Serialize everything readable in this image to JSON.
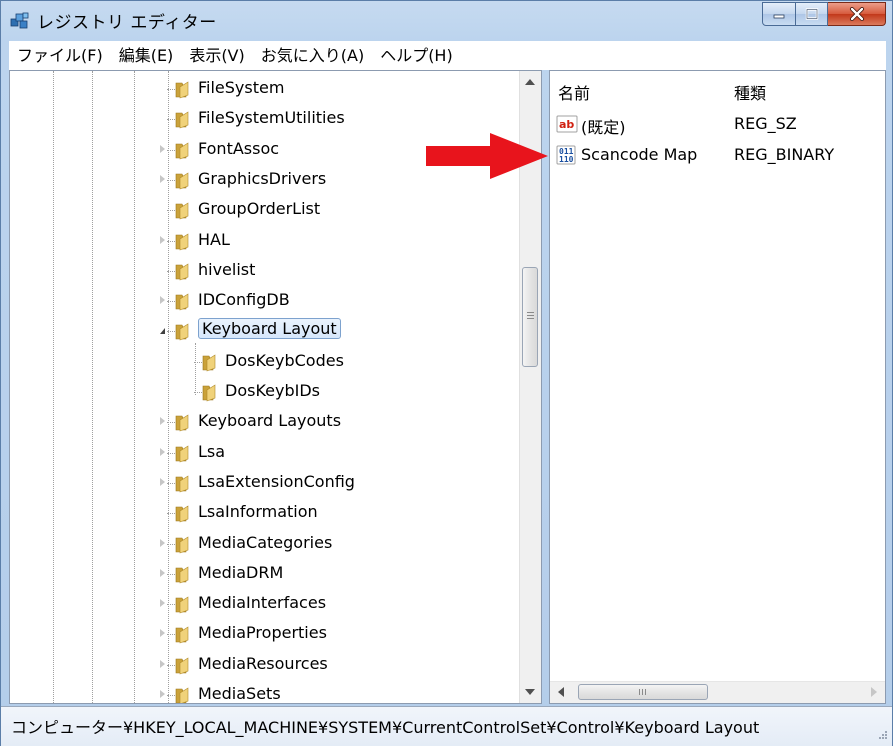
{
  "window": {
    "title": "レジストリ エディター",
    "accent_close": "#c7442a"
  },
  "menu": [
    {
      "label": "ファイル(F)"
    },
    {
      "label": "編集(E)"
    },
    {
      "label": "表示(V)"
    },
    {
      "label": "お気に入り(A)"
    },
    {
      "label": "ヘルプ(H)"
    }
  ],
  "tree": {
    "items": [
      {
        "label": "FileSystem",
        "expander": "none",
        "depth": 0
      },
      {
        "label": "FileSystemUtilities",
        "expander": "none",
        "depth": 0
      },
      {
        "label": "FontAssoc",
        "expander": "collapsed",
        "depth": 0
      },
      {
        "label": "GraphicsDrivers",
        "expander": "collapsed",
        "depth": 0
      },
      {
        "label": "GroupOrderList",
        "expander": "none",
        "depth": 0
      },
      {
        "label": "HAL",
        "expander": "collapsed",
        "depth": 0
      },
      {
        "label": "hivelist",
        "expander": "none",
        "depth": 0
      },
      {
        "label": "IDConfigDB",
        "expander": "collapsed",
        "depth": 0
      },
      {
        "label": "Keyboard Layout",
        "expander": "expanded",
        "depth": 0,
        "selected": true
      },
      {
        "label": "DosKeybCodes",
        "expander": "none",
        "depth": 1
      },
      {
        "label": "DosKeybIDs",
        "expander": "none",
        "depth": 1
      },
      {
        "label": "Keyboard Layouts",
        "expander": "collapsed",
        "depth": 0
      },
      {
        "label": "Lsa",
        "expander": "collapsed",
        "depth": 0
      },
      {
        "label": "LsaExtensionConfig",
        "expander": "collapsed",
        "depth": 0
      },
      {
        "label": "LsaInformation",
        "expander": "none",
        "depth": 0
      },
      {
        "label": "MediaCategories",
        "expander": "collapsed",
        "depth": 0
      },
      {
        "label": "MediaDRM",
        "expander": "collapsed",
        "depth": 0
      },
      {
        "label": "MediaInterfaces",
        "expander": "collapsed",
        "depth": 0
      },
      {
        "label": "MediaProperties",
        "expander": "collapsed",
        "depth": 0
      },
      {
        "label": "MediaResources",
        "expander": "collapsed",
        "depth": 0
      },
      {
        "label": "MediaSets",
        "expander": "collapsed",
        "depth": 0
      }
    ]
  },
  "list": {
    "columns": {
      "name": "名前",
      "type": "種類"
    },
    "rows": [
      {
        "name": "(既定)",
        "type": "REG_SZ",
        "icon": "string-value-icon"
      },
      {
        "name": "Scancode Map",
        "type": "REG_BINARY",
        "icon": "binary-value-icon"
      }
    ]
  },
  "annotation": {
    "arrow_color": "#e8141c"
  },
  "status": {
    "path": "コンピューター¥HKEY_LOCAL_MACHINE¥SYSTEM¥CurrentControlSet¥Control¥Keyboard Layout"
  }
}
